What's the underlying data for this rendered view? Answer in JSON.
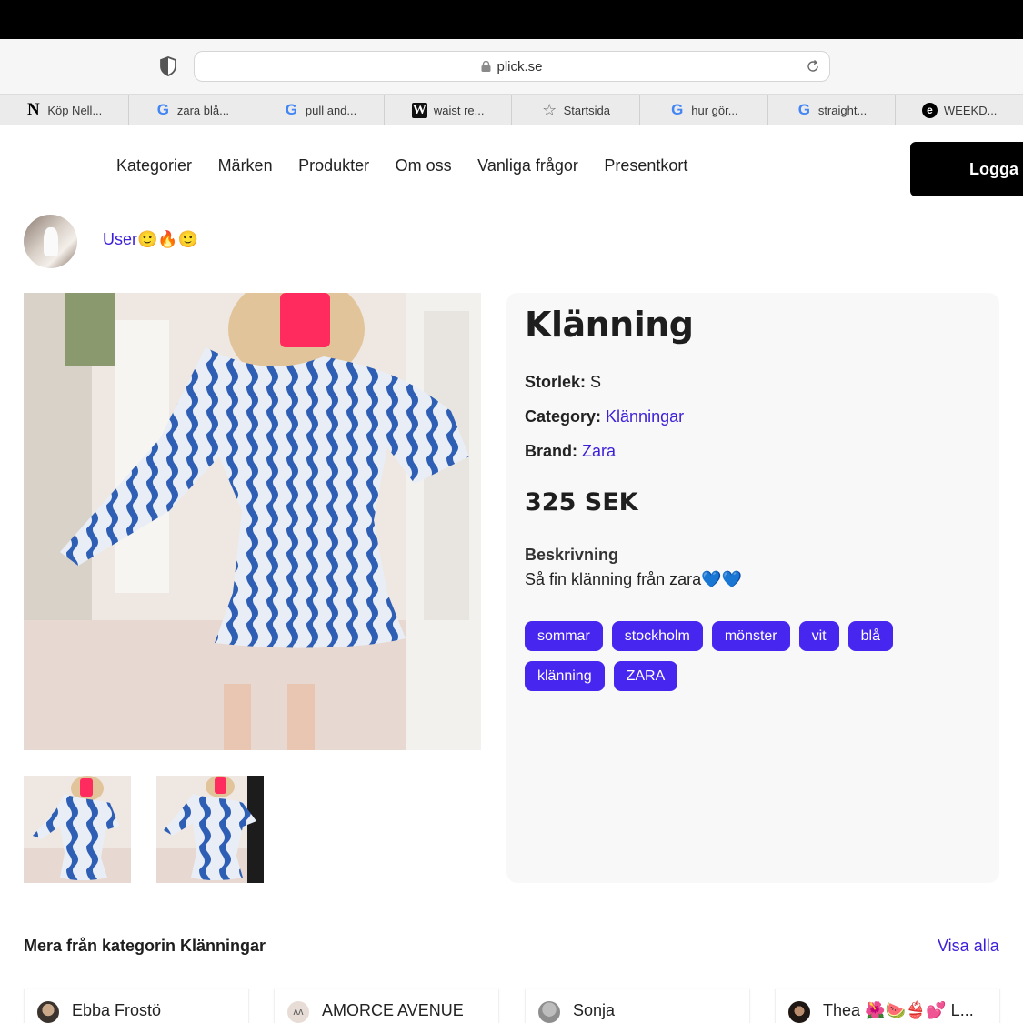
{
  "browser": {
    "url": "plick.se",
    "bookmarks": [
      {
        "icon": "notion-icon",
        "glyph": "N",
        "label": "Köp Nell..."
      },
      {
        "icon": "google-icon",
        "glyph": "G",
        "label": "zara blå..."
      },
      {
        "icon": "google-icon",
        "glyph": "G",
        "label": "pull and..."
      },
      {
        "icon": "w-icon",
        "glyph": "W",
        "label": "waist re..."
      },
      {
        "icon": "star-icon",
        "glyph": "☆",
        "label": "Startsida"
      },
      {
        "icon": "google-icon",
        "glyph": "G",
        "label": "hur gör..."
      },
      {
        "icon": "google-icon",
        "glyph": "G",
        "label": "straight..."
      },
      {
        "icon": "e-icon",
        "glyph": "e",
        "label": "WEEKD..."
      }
    ]
  },
  "nav": {
    "items": [
      "Kategorier",
      "Märken",
      "Produkter",
      "Om oss",
      "Vanliga frågor",
      "Presentkort"
    ],
    "login_label": "Logga"
  },
  "user": {
    "name": "User🙂🔥🙂"
  },
  "product": {
    "title": "Klänning",
    "size_label": "Storlek:",
    "size_value": "S",
    "category_label": "Category:",
    "category_value": "Klänningar",
    "brand_label": "Brand:",
    "brand_value": "Zara",
    "price": "325 SEK",
    "description_label": "Beskrivning",
    "description": "Så fin klänning från zara💙💙",
    "tags": [
      "sommar",
      "stockholm",
      "mönster",
      "vit",
      "blå",
      "klänning",
      "ZARA"
    ]
  },
  "more": {
    "title": "Mera från kategorin Klänningar",
    "see_all": "Visa alla",
    "sellers": [
      "Ebba Frostö",
      "AMORCE AVENUE",
      "Sonja",
      "Thea 🌺🍉👙💕 L..."
    ]
  },
  "colors": {
    "accent": "#4727f0",
    "link": "#3b1fd9",
    "login_bg": "#000000",
    "panel_bg": "#f8f8f8",
    "dress_blue": "#2f5fb5"
  }
}
